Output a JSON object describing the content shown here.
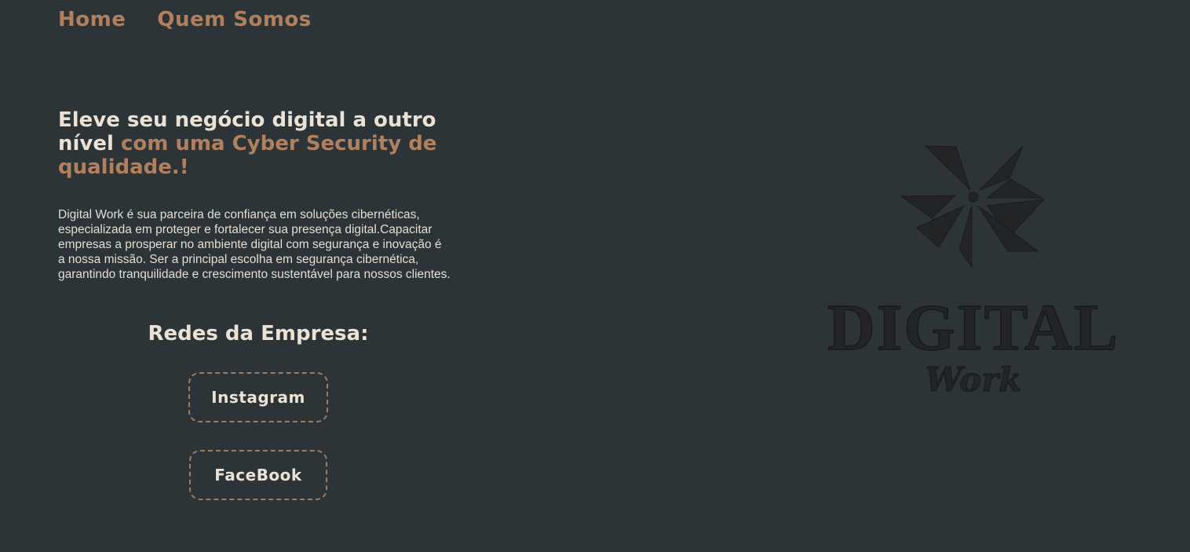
{
  "nav": {
    "items": [
      {
        "label": "Home"
      },
      {
        "label": "Quem Somos"
      }
    ]
  },
  "hero": {
    "title_plain": "Eleve seu negócio digital a outro nível",
    "title_accent": "com uma Cyber Security de qualidade.!",
    "description": "Digital Work é sua parceira de confiança em soluções cibernéticas, especializada em proteger e fortalecer sua presença digital.Capacitar empresas a prosperar no ambiente digital com segurança e inovação é a nossa missão. Ser a principal escolha em segurança cibernética, garantindo tranquilidade e crescimento sustentável para nossos clientes."
  },
  "social": {
    "title": "Redes da Empresa:",
    "instagram_label": "Instagram",
    "facebook_label": "FaceBook"
  },
  "logo": {
    "word_main": "DIGITAL",
    "word_sub": "Work",
    "color": "#232426"
  },
  "colors": {
    "background": "#2c3437",
    "accent": "#b1805f",
    "text": "#ebe2d4"
  }
}
